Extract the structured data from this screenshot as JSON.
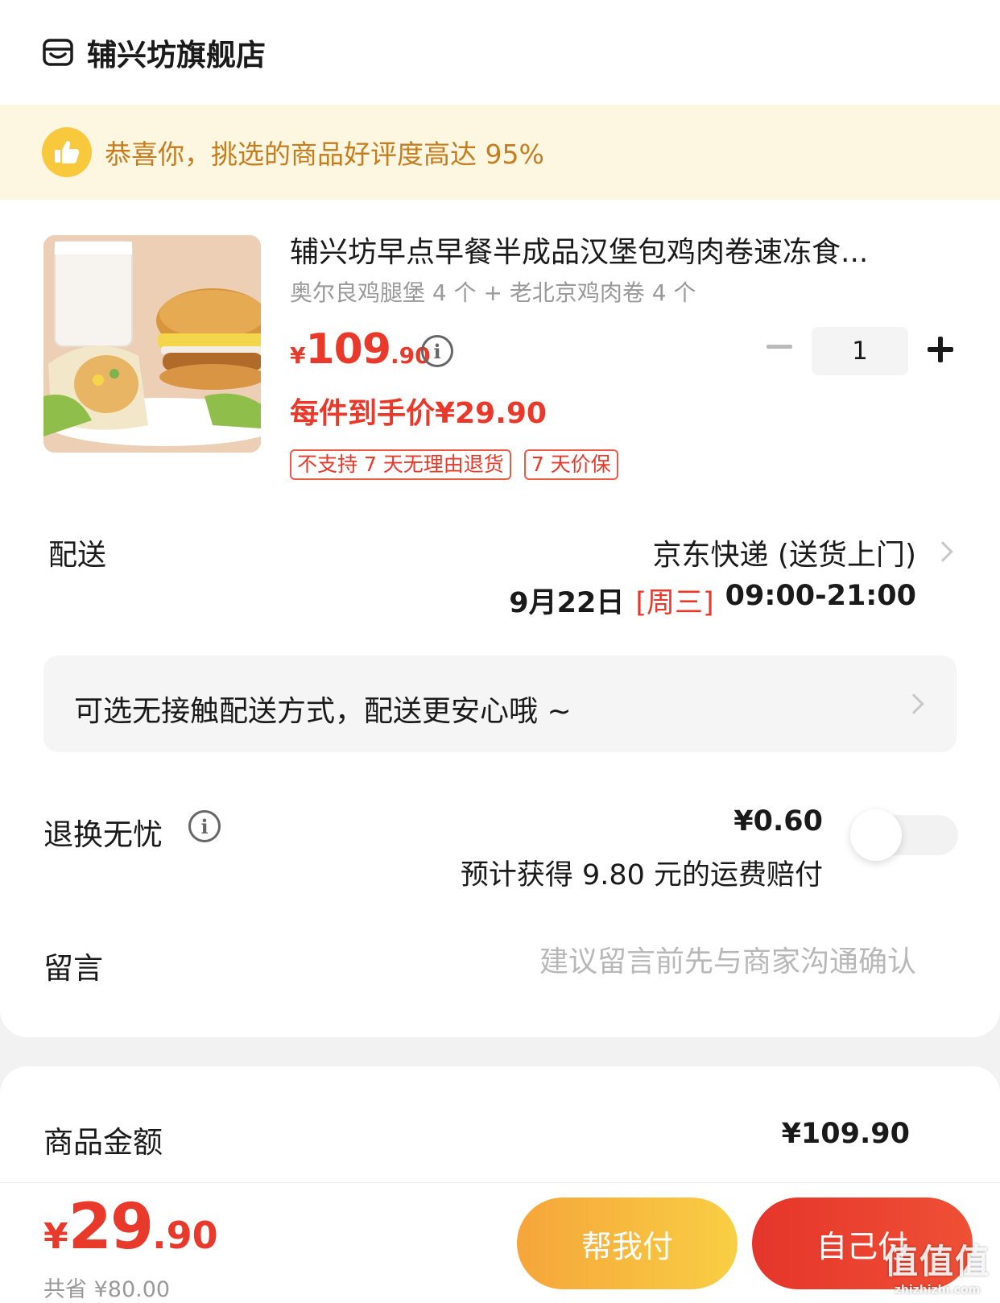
{
  "store": {
    "name": "辅兴坊旗舰店",
    "icon": "store-icon"
  },
  "praise": {
    "text": "恭喜你，挑选的商品好评度高达 95%",
    "icon": "thumbs-up-icon"
  },
  "product": {
    "title": "辅兴坊早点早餐半成品汉堡包鸡肉卷速冻食...",
    "spec": "奥尔良鸡腿堡 4 个 + 老北京鸡肉卷 4 个",
    "price_yen": "¥",
    "price_int": "109",
    "price_dec": ".90",
    "unit_price": "每件到手价¥29.90",
    "tags": [
      "不支持 7 天无理由退货",
      "7 天价保"
    ],
    "quantity": "1"
  },
  "delivery": {
    "label": "配送",
    "method": "京东快递 (送货上门)",
    "date": "9月22日",
    "weekday": "[周三]",
    "time_range": "09:00-21:00"
  },
  "contactless": {
    "text": "可选无接触配送方式，配送更安心哦 ~"
  },
  "return_worry": {
    "label": "退换无忧",
    "price": "¥0.60",
    "subtext": "预计获得 9.80 元的运费赔付",
    "enabled": false
  },
  "message": {
    "label": "留言",
    "placeholder": "建议留言前先与商家沟通确认"
  },
  "amount": {
    "label": "商品金额",
    "value": "¥109.90"
  },
  "footer": {
    "total_yen": "¥",
    "total_int": "29",
    "total_dec": ".90",
    "savings": "共省 ¥80.00",
    "help_pay_label": "帮我付",
    "self_pay_label": "自己付"
  },
  "watermark": {
    "main": "值值值",
    "sub": "zhizhizhi.com"
  },
  "colors": {
    "accent_red": "#e8392a",
    "praise_bg": "#fdf7e1",
    "praise_text": "#c47d1f",
    "help_btn": "#f6a53a",
    "self_btn": "#e5352b"
  }
}
